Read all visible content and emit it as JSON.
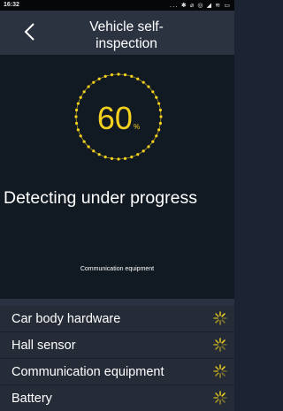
{
  "status_bar": {
    "time": "16:32",
    "icons_text": "... ✱ ⌀ ◎ ◢ ≋ ▭",
    "icons": [
      "more-dots-icon",
      "bluetooth-icon",
      "alarm-icon",
      "nfc-icon",
      "signal-icon",
      "wifi-icon",
      "battery-icon"
    ]
  },
  "header": {
    "title": "Vehicle self-inspection",
    "back_icon": "chevron-left-icon"
  },
  "progress": {
    "value": "60",
    "unit": "%",
    "ring_color": "#f4d11f"
  },
  "status": {
    "title": "Detecting under progress",
    "current_item": "Communication equipment"
  },
  "checks": [
    {
      "label": "Car body hardware",
      "state": "checking",
      "icon": "loading-spinner-icon"
    },
    {
      "label": "Hall sensor",
      "state": "checking",
      "icon": "loading-spinner-icon"
    },
    {
      "label": "Communication equipment",
      "state": "checking",
      "icon": "loading-spinner-icon"
    },
    {
      "label": "Battery",
      "state": "checking",
      "icon": "loading-spinner-icon"
    }
  ],
  "colors": {
    "accent": "#f4d11f",
    "background": "#111923",
    "header": "#2b3340",
    "list_background": "#252c37"
  }
}
